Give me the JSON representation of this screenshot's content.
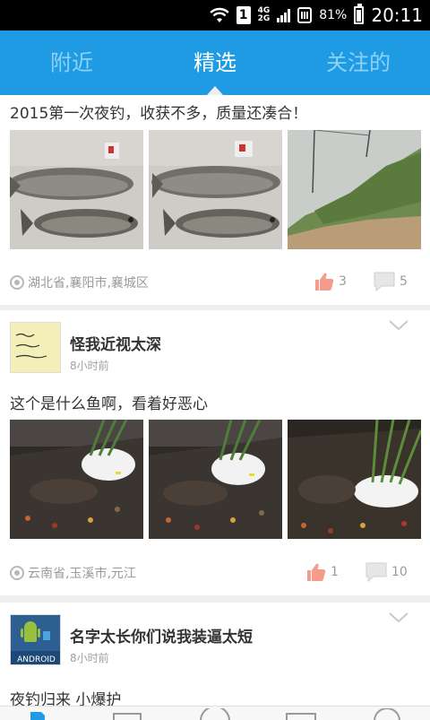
{
  "status_bar": {
    "sim_label": "1",
    "network_top": "4G",
    "network_bottom": "2G",
    "battery_percent": "81%",
    "time": "20:11",
    "icons": [
      "wifi-icon",
      "sim-icon",
      "signal-icon",
      "data-icon",
      "battery-icon"
    ]
  },
  "tabs": [
    {
      "label": "附近",
      "active": false
    },
    {
      "label": "精选",
      "active": true
    },
    {
      "label": "关注的",
      "active": false
    }
  ],
  "colors": {
    "header_bg": "#1e9be3",
    "tab_inactive": "#8dd2f6",
    "tab_active": "#ffffff",
    "like_icon": "#f59b8c"
  },
  "posts": [
    {
      "text": "2015第一次夜钓，收获不多，质量还凑合！",
      "images": [
        "fish-photo-1",
        "fish-photo-2",
        "riverbank-photo"
      ],
      "location": "湖北省,襄阳市,襄城区",
      "likes": "3",
      "comments": "5"
    },
    {
      "author": "怪我近视太深",
      "time": "8小时前",
      "text": "这个是什么鱼啊，看着好恶心",
      "images": [
        "aquarium-photo-1",
        "aquarium-photo-2",
        "aquarium-photo-3"
      ],
      "location": "云南省,玉溪市,元江",
      "likes": "1",
      "comments": "10"
    },
    {
      "author": "名字太长你们说我装逼太短",
      "time": "8小时前",
      "text": "夜钓归来  小爆护",
      "avatar_text": "ANDROID"
    }
  ],
  "bottom_nav": [
    "feed-icon",
    "list-icon",
    "compass-icon",
    "news-icon",
    "profile-icon"
  ]
}
